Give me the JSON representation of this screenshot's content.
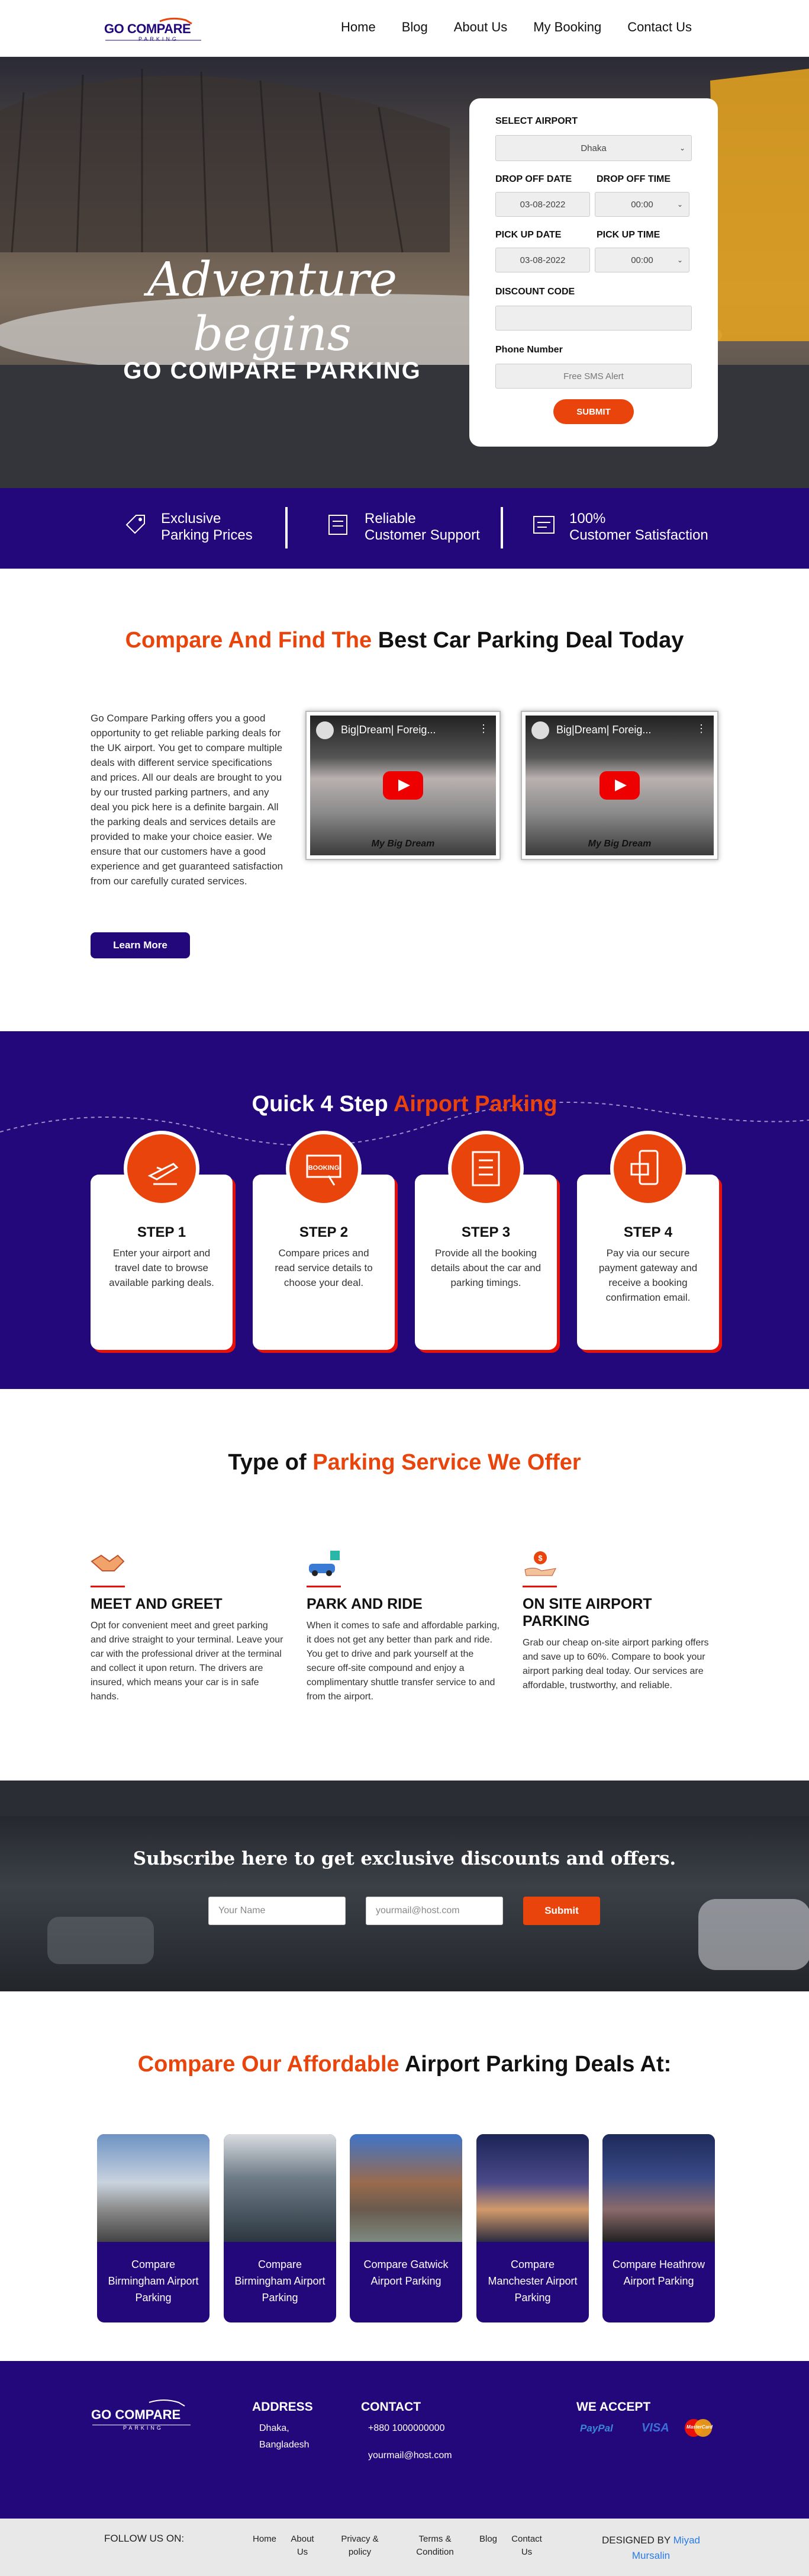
{
  "header": {
    "logo_text": "GO COMPARE",
    "logo_sub": "PARKING",
    "nav": [
      "Home",
      "Blog",
      "About Us",
      "My Booking",
      "Contact Us"
    ]
  },
  "hero": {
    "title_line1": "Adventure",
    "title_line2": "begins",
    "subtitle": "GO COMPARE PARKING"
  },
  "form": {
    "airport_label": "SELECT AIRPORT",
    "airport_value": "Dhaka",
    "dropoff_date_label": "DROP OFF DATE",
    "dropoff_time_label": "DROP OFF TIME",
    "dropoff_date": "03-08-2022",
    "dropoff_time": "00:00",
    "pickup_date_label": "PICK UP DATE",
    "pickup_time_label": "PICK UP TIME",
    "pickup_date": "03-08-2022",
    "pickup_time": "00:00",
    "discount_label": "DISCOUNT CODE",
    "phone_label": "Phone Number",
    "phone_placeholder": "Free SMS Alert",
    "submit": "SUBMIT"
  },
  "features": [
    {
      "l1": "Exclusive",
      "l2": "Parking Prices"
    },
    {
      "l1": "Reliable",
      "l2": "Customer Support"
    },
    {
      "l1": "100%",
      "l2": "Customer Satisfaction"
    }
  ],
  "compare": {
    "title_orange": "Compare And Find The",
    "title_dark": "Best Car Parking Deal Today",
    "text": "Go Compare Parking offers you a good opportunity to get reliable parking deals for the UK airport. You get to compare multiple deals with different service specifications and prices. All our deals are brought to you by our trusted parking partners, and any deal you pick here is a definite bargain. All the parking deals and services details are provided to make your choice easier. We ensure that our customers have a good experience and get guaranteed satisfaction from our carefully curated services.",
    "button": "Learn More",
    "video_title": "Big|Dream| Foreig...",
    "video_caption": "My Big Dream"
  },
  "steps": {
    "title_dark": "Quick 4 Step",
    "title_orange": "Airport Parking",
    "items": [
      {
        "title": "STEP 1",
        "text": "Enter your airport and travel date to browse available parking deals."
      },
      {
        "title": "STEP 2",
        "text": "Compare prices and read service details to choose your deal."
      },
      {
        "title": "STEP 3",
        "text": "Provide all the booking details about the car and parking timings."
      },
      {
        "title": "STEP 4",
        "text": "Pay via our secure payment gateway and receive a booking confirmation email."
      }
    ]
  },
  "services": {
    "title_dark": "Type of",
    "title_orange": "Parking Service We Offer",
    "items": [
      {
        "title": "MEET AND GREET",
        "text": "Opt for convenient meet and greet parking and drive straight to your terminal. Leave your car with the professional driver at the terminal and collect it upon return. The drivers are insured, which means your car is in safe hands."
      },
      {
        "title": "PARK AND RIDE",
        "text": "When it comes to safe and affordable parking, it does not get any better than park and ride. You get to drive and park yourself at the secure off-site compound and enjoy a complimentary shuttle transfer service to and from the airport."
      },
      {
        "title": "ON SITE AIRPORT PARKING",
        "text": "Grab our cheap on-site airport parking offers and save up to 60%. Compare to book your airport parking deal today. Our services are affordable, trustworthy, and reliable."
      }
    ]
  },
  "subscribe": {
    "title": "Subscribe here to get exclusive discounts and offers.",
    "name_placeholder": "Your Name",
    "email_placeholder": "yourmail@host.com",
    "button": "Submit"
  },
  "deals": {
    "title_orange": "Compare Our Affordable",
    "title_dark": "Airport Parking Deals At:",
    "items": [
      "Compare Birmingham Airport Parking",
      "Compare Birmingham Airport Parking",
      "Compare Gatwick Airport Parking",
      "Compare Manchester Airport Parking",
      "Compare Heathrow Airport Parking"
    ]
  },
  "footer": {
    "address_h": "ADDRESS",
    "address": [
      "Dhaka,",
      "Bangladesh"
    ],
    "contact_h": "CONTACT",
    "phone": "+880 1000000000",
    "email": "yourmail@host.com",
    "accept_h": "WE ACCEPT",
    "cards": [
      "PayPal",
      "VISA",
      "MasterCard"
    ]
  },
  "bottom": {
    "follow": "FOLLOW US ON:",
    "links": [
      "Home",
      "About Us",
      "Privacy & policy",
      "Terms & Condition",
      "Blog",
      "Contact Us"
    ],
    "designed": "DESIGNED BY",
    "author": "Miyad Mursalin"
  }
}
